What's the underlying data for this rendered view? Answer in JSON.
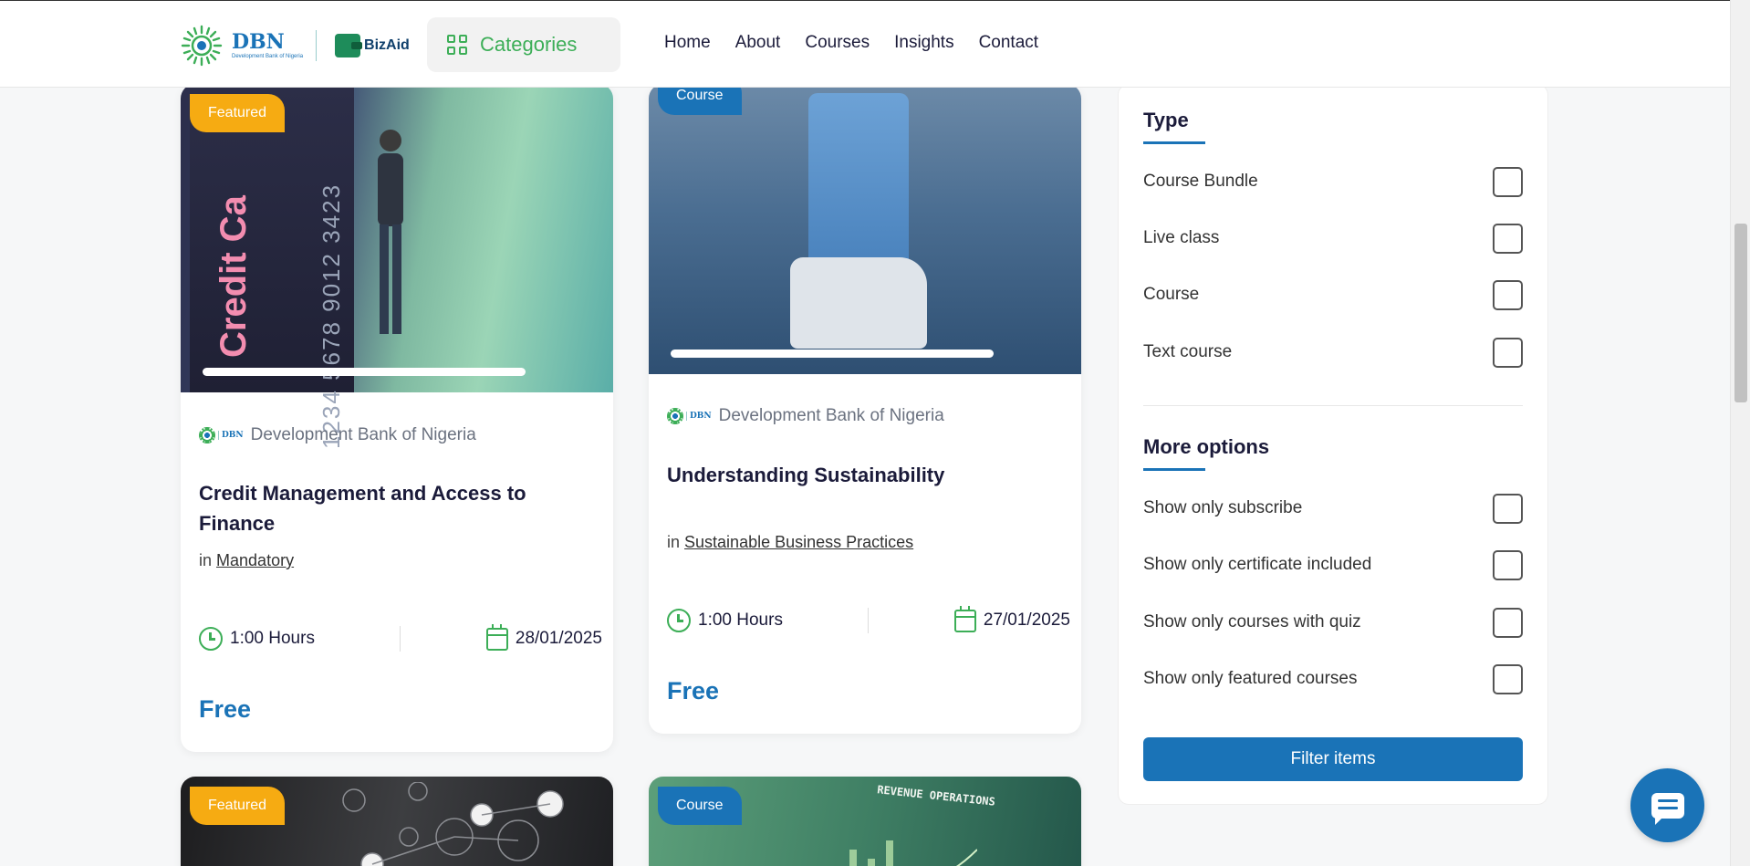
{
  "header": {
    "logo_dbn": "DBN",
    "logo_dbn_sub": "Development Bank of Nigeria",
    "logo_bizaid": "BizAid",
    "categories_label": "Categories",
    "nav": [
      "Home",
      "About",
      "Courses",
      "Insights",
      "Contact"
    ]
  },
  "cards": [
    {
      "badge": "Featured",
      "provider": "Development Bank of Nigeria",
      "provider_logo": "DBN",
      "title": "Credit Management and Access to Finance",
      "category_prefix": "in",
      "category": "Mandatory",
      "duration": "1:00 Hours",
      "date": "28/01/2025",
      "price": "Free",
      "thumbnail_text": "Credit Ca",
      "thumbnail_number": "1234 5678 9012 3423"
    },
    {
      "badge": "Course",
      "provider": "Development Bank of Nigeria",
      "provider_logo": "DBN",
      "title": "Understanding Sustainability",
      "category_prefix": "in",
      "category": "Sustainable Business Practices",
      "duration": "1:00 Hours",
      "date": "27/01/2025",
      "price": "Free"
    },
    {
      "badge": "Featured"
    },
    {
      "badge": "Course",
      "thumbnail_text": "REVENUE OPERATIONS"
    }
  ],
  "filter": {
    "type_title": "Type",
    "type_options": [
      "Course Bundle",
      "Live class",
      "Course",
      "Text course"
    ],
    "more_title": "More options",
    "more_options": [
      "Show only subscribe",
      "Show only certificate included",
      "Show only courses with quiz",
      "Show only featured courses"
    ],
    "button": "Filter items"
  },
  "colors": {
    "brand_blue": "#1a73b7",
    "brand_green": "#3cae57",
    "featured_orange": "#f6ab12"
  },
  "icons": {
    "chat": "chat-bubble-icon",
    "categories": "grid-icon",
    "duration": "clock-icon",
    "date": "calendar-icon"
  }
}
